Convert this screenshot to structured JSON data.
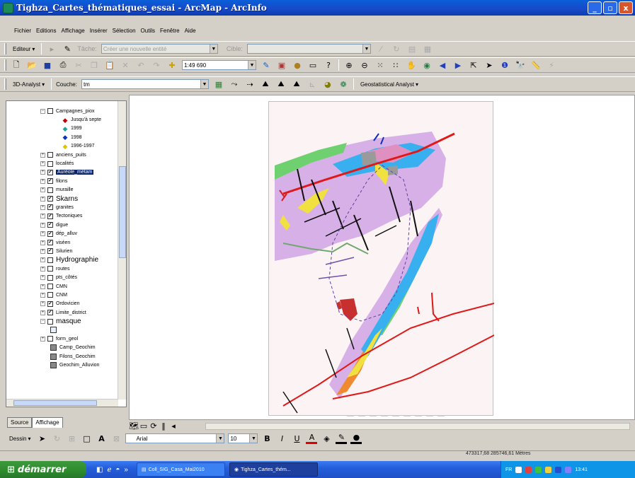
{
  "window": {
    "title": "Tighza_Cartes_thématiques_essai - ArcMap - ArcInfo",
    "controls": [
      "_",
      "▫",
      "x"
    ]
  },
  "menu": [
    "Fichier",
    "Editions",
    "Affichage",
    "Insérer",
    "Sélection",
    "Outils",
    "Fenêtre",
    "Aide"
  ],
  "editor_toolbar": {
    "editor_label": "Editeur",
    "task_label": "Tâche:",
    "task_value": "Créer une nouvelle entité",
    "target_label": "Cible:",
    "target_value": ""
  },
  "standard_toolbar": {
    "scale": "1:49 690"
  },
  "analysis_toolbar": {
    "analyst_3d": "3D-Analyst",
    "layer_label": "Couche:",
    "layer_value": "tm",
    "geostat": "Geostatistical Analyst"
  },
  "toc": {
    "items": [
      {
        "kind": "layer",
        "expand": "−",
        "check": false,
        "label": "Campagnes_piox",
        "indent": 0
      },
      {
        "kind": "symbol",
        "symbol": "◆",
        "color": "#c00000",
        "label": "Jusqu'à septe"
      },
      {
        "kind": "symbol",
        "symbol": "◆",
        "color": "#22a0a0",
        "label": "1999"
      },
      {
        "kind": "symbol",
        "symbol": "◆",
        "color": "#1030c0",
        "label": "1998"
      },
      {
        "kind": "symbol",
        "symbol": "◆",
        "color": "#e0c000",
        "label": "1996-1997"
      },
      {
        "kind": "layer",
        "expand": "+",
        "check": false,
        "label": "anciens_puits"
      },
      {
        "kind": "layer",
        "expand": "+",
        "check": false,
        "label": "localités"
      },
      {
        "kind": "layer",
        "expand": "+",
        "check": true,
        "label": "Auréole_métam",
        "selected": true
      },
      {
        "kind": "layer",
        "expand": "+",
        "check": true,
        "label": "filons"
      },
      {
        "kind": "layer",
        "expand": "+",
        "check": false,
        "label": "muraille"
      },
      {
        "kind": "layer",
        "expand": "+",
        "check": true,
        "label": "Skarns",
        "big": true
      },
      {
        "kind": "layer",
        "expand": "+",
        "check": true,
        "label": "granites"
      },
      {
        "kind": "layer",
        "expand": "+",
        "check": true,
        "label": "Tectoniques"
      },
      {
        "kind": "layer",
        "expand": "+",
        "check": true,
        "label": "digue"
      },
      {
        "kind": "layer",
        "expand": "+",
        "check": true,
        "label": "dép_alluv"
      },
      {
        "kind": "layer",
        "expand": "+",
        "check": true,
        "label": "viséen"
      },
      {
        "kind": "layer",
        "expand": "+",
        "check": true,
        "label": "Silurien"
      },
      {
        "kind": "layer",
        "expand": "+",
        "check": false,
        "label": "Hydrographie",
        "big": true
      },
      {
        "kind": "layer",
        "expand": "+",
        "check": false,
        "label": "routes"
      },
      {
        "kind": "layer",
        "expand": "+",
        "check": false,
        "label": "pts_côtés"
      },
      {
        "kind": "layer",
        "expand": "+",
        "check": false,
        "label": "CMN"
      },
      {
        "kind": "layer",
        "expand": "+",
        "check": false,
        "label": "CNM"
      },
      {
        "kind": "layer",
        "expand": "+",
        "check": true,
        "label": "Ordovicien"
      },
      {
        "kind": "layer",
        "expand": "+",
        "check": true,
        "label": "Limite_district"
      },
      {
        "kind": "layer",
        "expand": "−",
        "check": false,
        "label": "masque",
        "big": true
      },
      {
        "kind": "swatch",
        "color": "#e8f0ff",
        "label": ""
      },
      {
        "kind": "layer",
        "expand": "+",
        "check": false,
        "label": "form_geol"
      },
      {
        "kind": "swatch",
        "color": "#888888",
        "label": "Camp_Geochim"
      },
      {
        "kind": "swatch",
        "color": "#888888",
        "label": "Filons_Geochim"
      },
      {
        "kind": "swatch",
        "color": "#888888",
        "label": "Geochim_Alluvion"
      }
    ],
    "tabs": [
      "Source",
      "Affichage"
    ]
  },
  "draw_toolbar": {
    "dessin": "Dessin",
    "font": "Arial",
    "size": "10"
  },
  "status": {
    "coordinates": "473317,68 285746,61 Mètres"
  },
  "taskbar": {
    "start": "démarrer",
    "tasks": [
      "Coll_SIG_Casa_Mai2010",
      "Tighza_Cartes_thém..."
    ],
    "tray_lang": "FR",
    "time": "13:41"
  },
  "colors": {
    "title_blue": "#1848c8",
    "start_green": "#2d8a2d",
    "selection": "#0a246a"
  }
}
